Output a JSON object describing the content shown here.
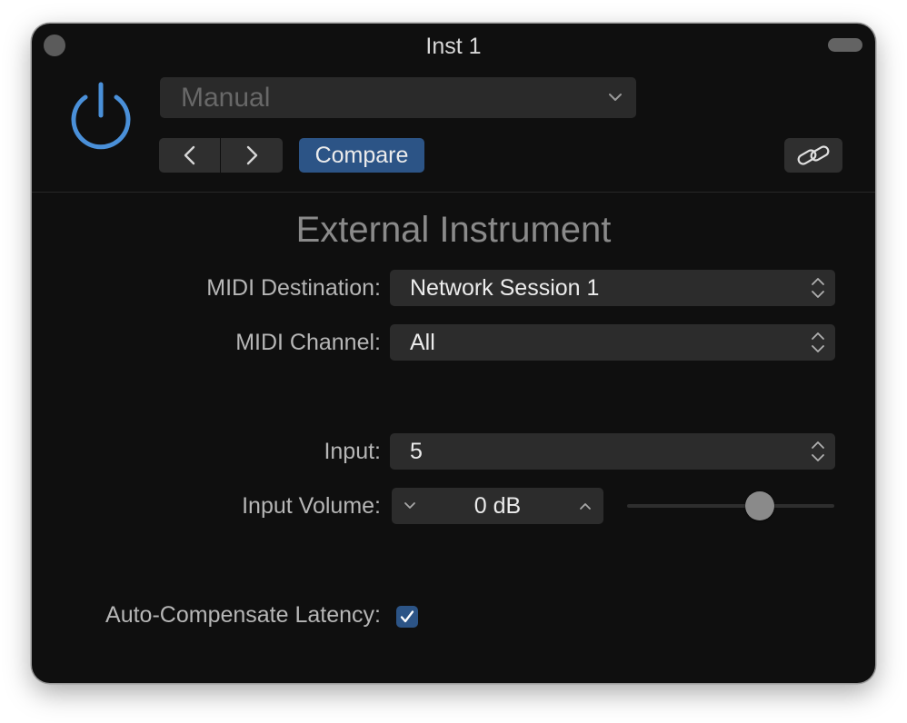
{
  "window": {
    "title": "Inst 1"
  },
  "header": {
    "preset": {
      "value": "Manual"
    },
    "compare_label": "Compare"
  },
  "plugin": {
    "title": "External Instrument",
    "midi_destination": {
      "label": "MIDI Destination:",
      "value": "Network Session 1"
    },
    "midi_channel": {
      "label": "MIDI Channel:",
      "value": "All"
    },
    "input": {
      "label": "Input:",
      "value": "5"
    },
    "input_volume": {
      "label": "Input Volume:",
      "value": "0 dB",
      "slider_fraction": 0.64
    },
    "auto_compensate": {
      "label": "Auto-Compensate Latency:",
      "checked": true
    }
  },
  "colors": {
    "accent": "#2c5486",
    "power_icon": "#4a90d9",
    "window_bg": "#0f0f0f"
  },
  "icons": {
    "power": "power-icon",
    "prev": "chevron-left-icon",
    "next": "chevron-right-icon",
    "link": "link-icon",
    "dropdown": "chevron-down-icon",
    "updown": "updown-arrows-icon",
    "check": "checkmark-icon"
  }
}
